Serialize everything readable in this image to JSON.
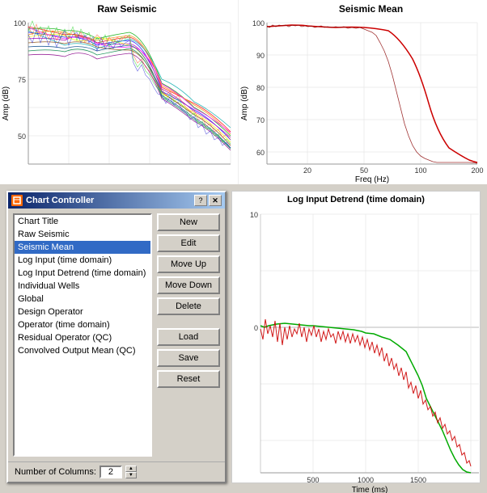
{
  "top_charts": {
    "raw_seismic": {
      "title": "Raw Seismic",
      "y_label": "Amp (dB)",
      "y_max": 100,
      "y_min": 50
    },
    "seismic_mean": {
      "title": "Seismic Mean",
      "y_label": "Amp (dB)",
      "x_label": "Freq (Hz)",
      "y_max": 100,
      "y_min": 60
    }
  },
  "bottom_chart": {
    "title": "Log Input Detrend (time domain)",
    "y_label": "",
    "x_label": "Time (ms)",
    "x_ticks": [
      "500",
      "1000",
      "1500"
    ],
    "y_ticks": [
      "10",
      "0"
    ]
  },
  "dialog": {
    "title": "Chart Controller",
    "items": [
      "Chart Title",
      "Raw Seismic",
      "Seismic Mean",
      "Log Input (time domain)",
      "Log Input Detrend (time domain)",
      "Individual Wells",
      "Global",
      "Design Operator",
      "Operator (time domain)",
      "Residual Operator (QC)",
      "Convolved Output Mean (QC)"
    ],
    "selected_index": 2,
    "buttons": {
      "new": "New",
      "edit": "Edit",
      "move_up": "Move Up",
      "move_down": "Move Down",
      "delete": "Delete",
      "load": "Load",
      "save": "Save",
      "reset": "Reset"
    },
    "footer": {
      "label": "Number of Columns:",
      "value": "2"
    },
    "help_btn": "?",
    "close_btn": "✕"
  }
}
